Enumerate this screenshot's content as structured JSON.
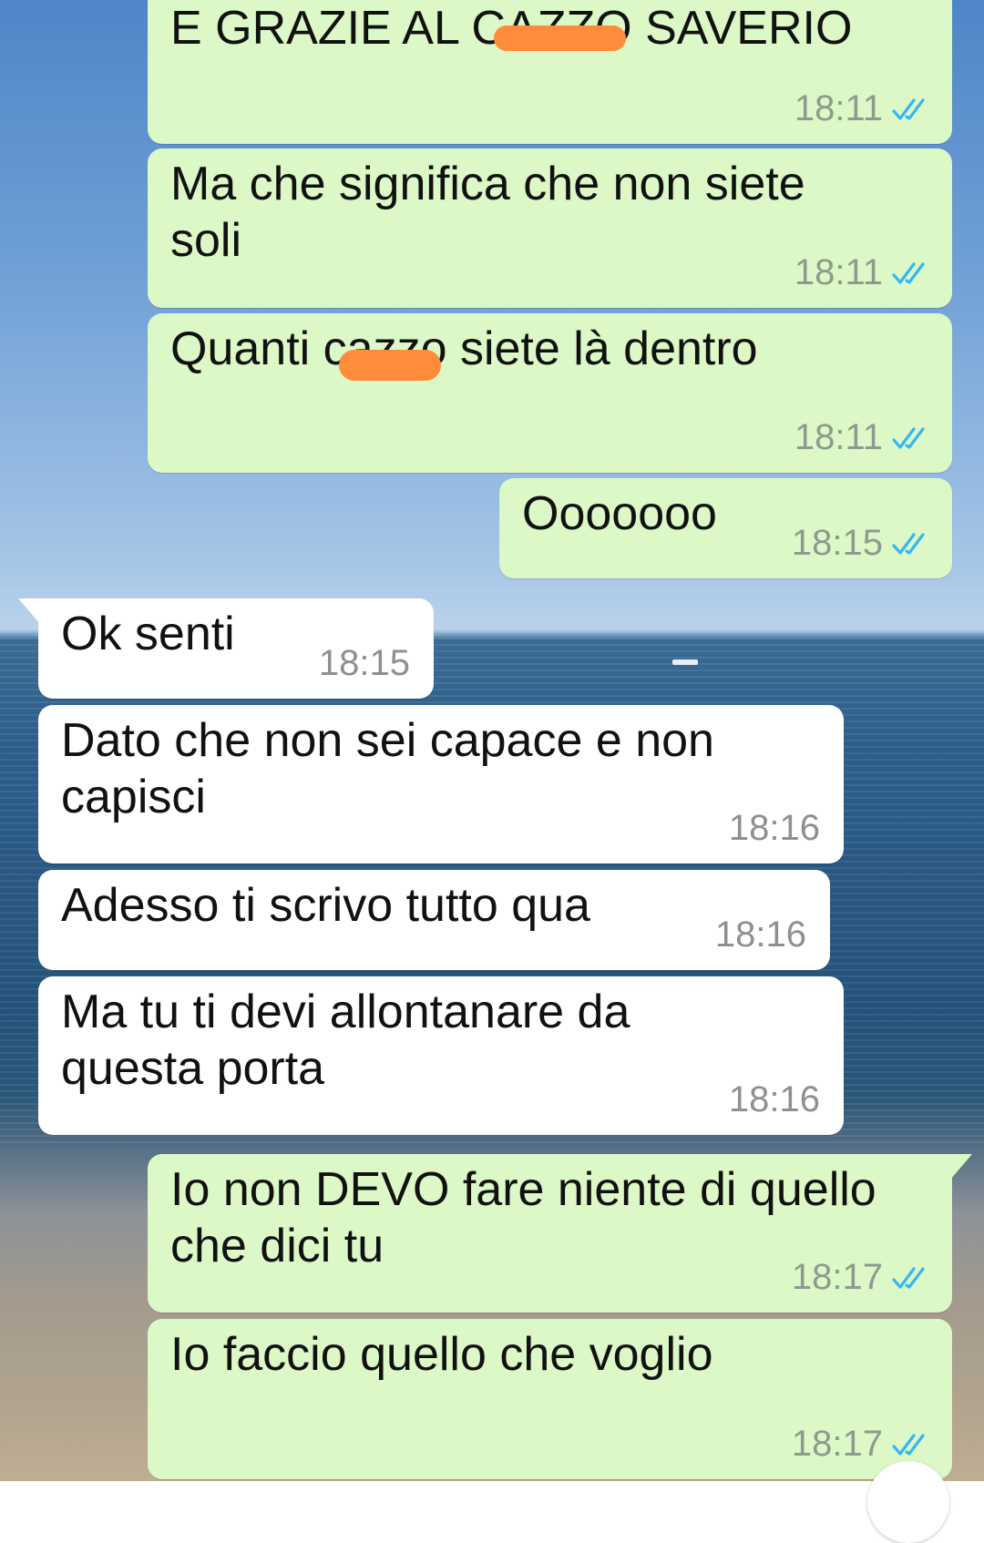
{
  "messages": [
    {
      "text": "E GRAZIE AL CAZZO SAVERIO",
      "time": "18:11",
      "direction": "outgoing",
      "status": "read"
    },
    {
      "text": "Ma che significa che non siete\nsoli",
      "time": "18:11",
      "direction": "outgoing",
      "status": "read"
    },
    {
      "text": "Quanti cazzo siete là dentro",
      "time": "18:11",
      "direction": "outgoing",
      "status": "read"
    },
    {
      "text": "Ooooooo",
      "time": "18:15",
      "direction": "outgoing",
      "status": "read"
    },
    {
      "text": "Ok senti",
      "time": "18:15",
      "direction": "incoming"
    },
    {
      "text": "Dato che non sei capace e non\ncapisci",
      "time": "18:16",
      "direction": "incoming"
    },
    {
      "text": "Adesso ti scrivo tutto qua",
      "time": "18:16",
      "direction": "incoming"
    },
    {
      "text": "Ma tu ti devi allontanare da\nquesta porta",
      "time": "18:16",
      "direction": "incoming"
    },
    {
      "text": "Io non DEVO fare niente di quello\nche dici tu",
      "time": "18:17",
      "direction": "outgoing",
      "status": "read"
    },
    {
      "text": "Io faccio quello che voglio",
      "time": "18:17",
      "direction": "outgoing",
      "status": "read"
    }
  ],
  "icons": {
    "read_receipt": "double-check-icon",
    "scroll_down": "scroll-down-icon"
  },
  "colors": {
    "outgoing_bubble": "#dcf8c6",
    "incoming_bubble": "#ffffff",
    "read_ticks": "#34b7f1",
    "redaction": "#ff8c3a"
  }
}
